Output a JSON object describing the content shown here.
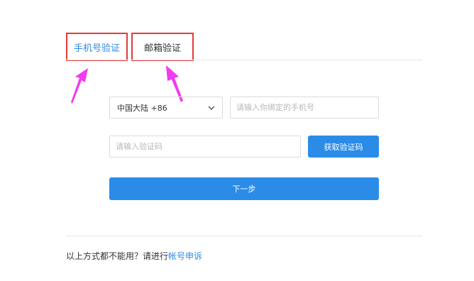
{
  "tabs": [
    {
      "label": "手机号验证",
      "active": true
    },
    {
      "label": "邮箱验证",
      "active": false
    }
  ],
  "form": {
    "region_select": {
      "value": "中国大陆 +86",
      "icon": "chevron-down-icon"
    },
    "phone_input": {
      "value": "",
      "placeholder": "请输入你绑定的手机号"
    },
    "code_input": {
      "value": "",
      "placeholder": "请输入验证码"
    },
    "get_code_label": "获取验证码",
    "next_label": "下一步"
  },
  "footer": {
    "text": "以上方式都不能用？请进行",
    "link": "帐号申诉"
  },
  "colors": {
    "accent": "#2b8ce8",
    "annotation_box": "#e43a3a",
    "annotation_arrow": "#f23af2"
  }
}
